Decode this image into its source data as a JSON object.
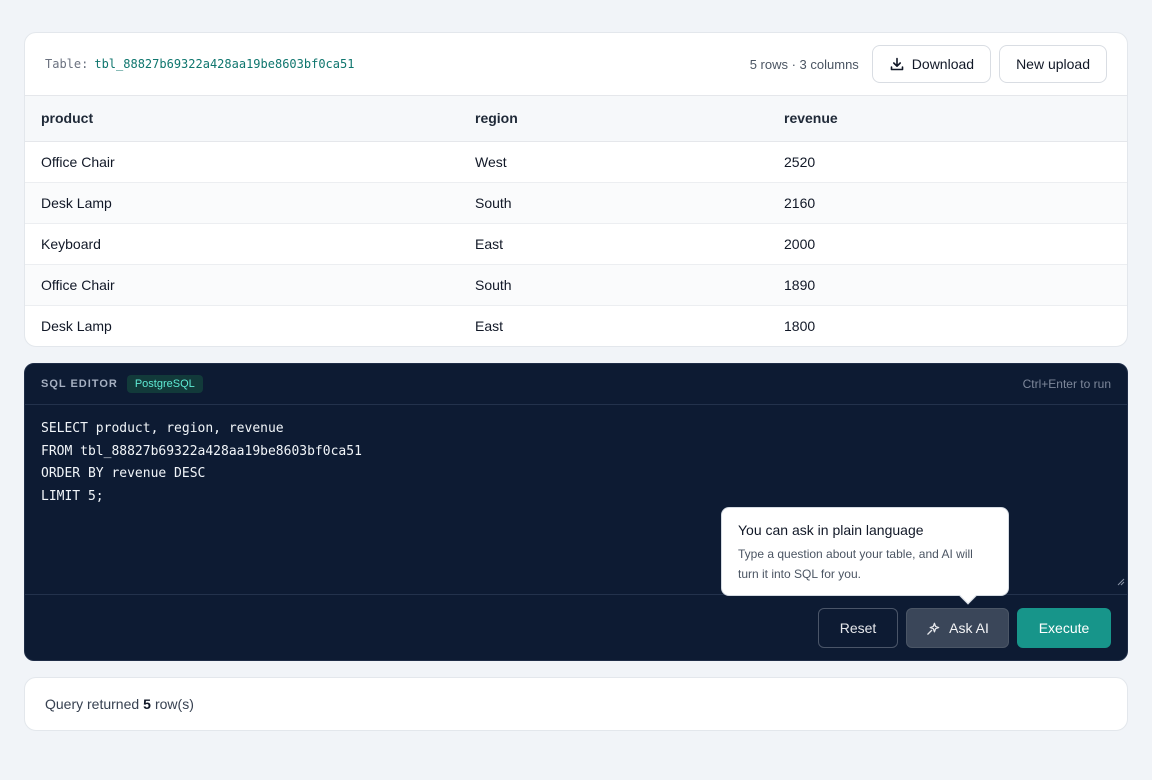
{
  "table_card": {
    "label": "Table:",
    "table_name": "tbl_88827b69322a428aa19be8603bf0ca51",
    "row_info": "5 rows · 3 columns",
    "download_label": "Download",
    "new_upload_label": "New upload"
  },
  "table": {
    "columns": [
      "product",
      "region",
      "revenue"
    ],
    "rows": [
      [
        "Office Chair",
        "West",
        "2520"
      ],
      [
        "Desk Lamp",
        "South",
        "2160"
      ],
      [
        "Keyboard",
        "East",
        "2000"
      ],
      [
        "Office Chair",
        "South",
        "1890"
      ],
      [
        "Desk Lamp",
        "East",
        "1800"
      ]
    ]
  },
  "editor": {
    "title": "SQL EDITOR",
    "dialect": "PostgreSQL",
    "hint": "Ctrl+Enter to run",
    "code": "SELECT product, region, revenue\nFROM tbl_88827b69322a428aa19be8603bf0ca51\nORDER BY revenue DESC\nLIMIT 5;",
    "reset_label": "Reset",
    "ask_ai_label": "Ask AI",
    "execute_label": "Execute"
  },
  "tooltip": {
    "title": "You can ask in plain language",
    "body": "Type a question about your table, and AI will turn it into SQL for you."
  },
  "status": {
    "prefix": "Query returned",
    "count": "5",
    "suffix": "row(s)"
  },
  "colors": {
    "accent": "#17958a",
    "editor_bg": "#0d1b33",
    "table_name": "#0f766e"
  },
  "icons": [
    "download-icon",
    "sparkle-icon",
    "resize-handle-icon"
  ]
}
